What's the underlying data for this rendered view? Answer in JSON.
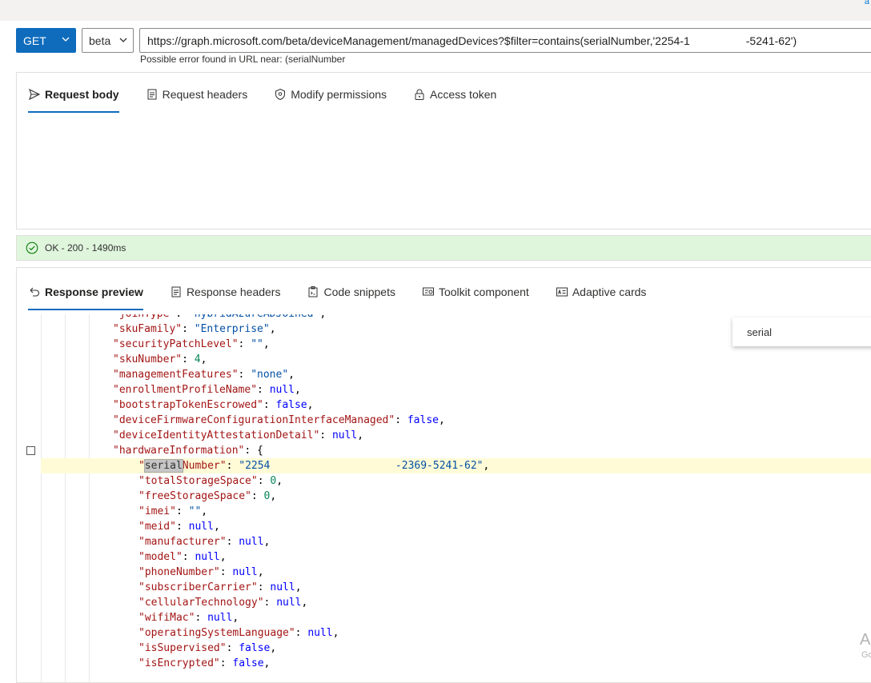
{
  "top": {
    "corner_text": "a"
  },
  "request": {
    "method": "GET",
    "version": "beta",
    "url": "https://graph.microsoft.com/beta/deviceManagement/managedDevices?$filter=contains(serialNumber,'2254-1                  -5241-62')",
    "error_text": "Possible error found in URL near: (serialNumber"
  },
  "request_tabs": [
    {
      "label": "Request body",
      "icon": "send-icon",
      "active": true
    },
    {
      "label": "Request headers",
      "icon": "document-icon",
      "active": false
    },
    {
      "label": "Modify permissions",
      "icon": "shield-icon",
      "active": false
    },
    {
      "label": "Access token",
      "icon": "lock-icon",
      "active": false
    }
  ],
  "status": {
    "text": "OK - 200 - 1490ms",
    "icon": "check-circle-icon",
    "color": "#dff6dd"
  },
  "response_tabs": [
    {
      "label": "Response preview",
      "icon": "undo-arrow-icon",
      "active": true
    },
    {
      "label": "Response headers",
      "icon": "document-icon",
      "active": false
    },
    {
      "label": "Code snippets",
      "icon": "snippet-icon",
      "active": false
    },
    {
      "label": "Toolkit component",
      "icon": "toolkit-icon",
      "active": false
    },
    {
      "label": "Adaptive cards",
      "icon": "card-icon",
      "active": false
    }
  ],
  "find": {
    "value": "serial"
  },
  "code_lines": [
    {
      "indent": 1,
      "key": "joinType",
      "value": "\"hybridAzureADJoined\"",
      "vtype": "s",
      "comma": true
    },
    {
      "indent": 1,
      "key": "skuFamily",
      "value": "\"Enterprise\"",
      "vtype": "s",
      "comma": true
    },
    {
      "indent": 1,
      "key": "securityPatchLevel",
      "value": "\"\"",
      "vtype": "s",
      "comma": true
    },
    {
      "indent": 1,
      "key": "skuNumber",
      "value": "4",
      "vtype": "n",
      "comma": true
    },
    {
      "indent": 1,
      "key": "managementFeatures",
      "value": "\"none\"",
      "vtype": "s",
      "comma": true
    },
    {
      "indent": 1,
      "key": "enrollmentProfileName",
      "value": "null",
      "vtype": "b",
      "comma": true
    },
    {
      "indent": 1,
      "key": "bootstrapTokenEscrowed",
      "value": "false",
      "vtype": "b",
      "comma": true
    },
    {
      "indent": 1,
      "key": "deviceFirmwareConfigurationInterfaceManaged",
      "value": "false",
      "vtype": "b",
      "comma": true
    },
    {
      "indent": 1,
      "key": "deviceIdentityAttestationDetail",
      "value": "null",
      "vtype": "b",
      "comma": true
    },
    {
      "indent": 1,
      "key": "hardwareInformation",
      "value": "{",
      "vtype": "p",
      "comma": false,
      "fold": true
    },
    {
      "indent": 2,
      "key": "serialNumber",
      "value": "\"2254                    -2369-5241-62\"",
      "vtype": "s",
      "comma": true,
      "highlight": true
    },
    {
      "indent": 2,
      "key": "totalStorageSpace",
      "value": "0",
      "vtype": "n",
      "comma": true
    },
    {
      "indent": 2,
      "key": "freeStorageSpace",
      "value": "0",
      "vtype": "n",
      "comma": true
    },
    {
      "indent": 2,
      "key": "imei",
      "value": "\"\"",
      "vtype": "s",
      "comma": true
    },
    {
      "indent": 2,
      "key": "meid",
      "value": "null",
      "vtype": "b",
      "comma": true
    },
    {
      "indent": 2,
      "key": "manufacturer",
      "value": "null",
      "vtype": "b",
      "comma": true
    },
    {
      "indent": 2,
      "key": "model",
      "value": "null",
      "vtype": "b",
      "comma": true
    },
    {
      "indent": 2,
      "key": "phoneNumber",
      "value": "null",
      "vtype": "b",
      "comma": true
    },
    {
      "indent": 2,
      "key": "subscriberCarrier",
      "value": "null",
      "vtype": "b",
      "comma": true
    },
    {
      "indent": 2,
      "key": "cellularTechnology",
      "value": "null",
      "vtype": "b",
      "comma": true
    },
    {
      "indent": 2,
      "key": "wifiMac",
      "value": "null",
      "vtype": "b",
      "comma": true
    },
    {
      "indent": 2,
      "key": "operatingSystemLanguage",
      "value": "null",
      "vtype": "b",
      "comma": true
    },
    {
      "indent": 2,
      "key": "isSupervised",
      "value": "false",
      "vtype": "b",
      "comma": true
    },
    {
      "indent": 2,
      "key": "isEncrypted",
      "value": "false",
      "vtype": "b",
      "comma": true
    }
  ],
  "watermark": {
    "line1": "A",
    "line2": "Go"
  }
}
